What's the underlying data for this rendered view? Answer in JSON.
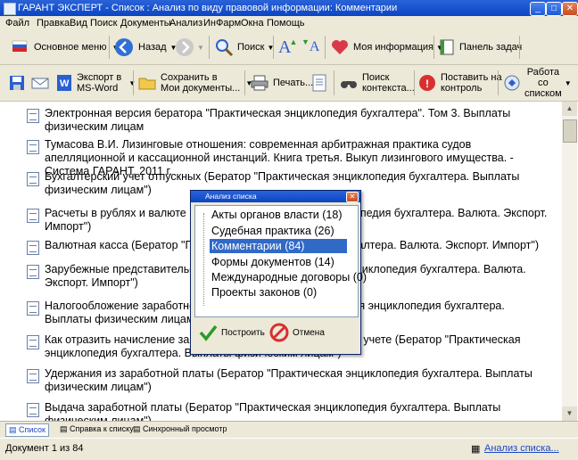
{
  "window": {
    "title": "ГАРАНТ ЭКСПЕРТ - Список : Анализ по виду правовой информации: Комментарии",
    "buttons": {
      "minimize": "_",
      "maximize": "□",
      "close": "✕"
    }
  },
  "menu": [
    "Файл",
    "Правка",
    "Вид",
    "Поиск",
    "Документы",
    "Анализ",
    "ИнФарм",
    "Окна",
    "Помощь"
  ],
  "toolbar1": {
    "main_menu": "Основное меню",
    "back": "Назад",
    "search": "Поиск",
    "my_info": "Моя информация",
    "tasks_panel": "Панель задач"
  },
  "toolbar2": {
    "export_l1": "Экспорт в",
    "export_l2": "MS-Word",
    "save_l1": "Сохранить в",
    "save_l2": "Мои документы...",
    "print": "Печать...",
    "ctx_l1": "Поиск",
    "ctx_l2": "контекста...",
    "control_l1": "Поставить на",
    "control_l2": "контроль",
    "work_l1": "Работа",
    "work_l2": "со",
    "work_l3": "списком"
  },
  "documents": [
    "Электронная версия бератора \"Практическая энциклопедия бухгалтера\". Том 3. Выплаты физическим лицам",
    "Тумасова В.И. Лизинговые отношения: современная арбитражная практика судов апелляционной и кассационной инстанций. Книга третья. Выкуп лизингового имущества. - Система ГАРАНТ, 2011 г.",
    "Бухгалтерский учет отпускных (Бератор \"Практическая энциклопедия бухгалтера. Выплаты физическим лицам\")",
    "Расчеты в рублях и валюте (Бератор \"Практическая энциклопедия бухгалтера. Валюта. Экспорт. Импорт\")",
    "Валютная касса (Бератор \"Практическая энциклопедия бухгалтера. Валюта. Экспорт. Импорт\")",
    "Зарубежные представительства (Бератор \"Практическая энциклопедия бухгалтера. Валюта. Экспорт. Импорт\")",
    "Налогообложение заработной платы (Бератор \"Практическая энциклопедия бухгалтера. Выплаты физическим лицам\")",
    "Как отразить начисление заработной платы в бухгалтерском учете (Бератор \"Практическая энциклопедия бухгалтера. Выплаты физическим лицам\")",
    "Удержания из заработной платы (Бератор \"Практическая энциклопедия бухгалтера. Выплаты физическим лицам\")",
    "Выдача заработной платы (Бератор \"Практическая энциклопедия бухгалтера. Выплаты физическим лицам\")"
  ],
  "dialog": {
    "title": "Анализ списка",
    "items": [
      "Акты органов власти (18)",
      "Судебная практика (26)",
      "Комментарии (84)",
      "Формы документов (14)",
      "Международные договоры (0)",
      "Проекты законов (0)"
    ],
    "selected_index": 2,
    "build": "Построить",
    "cancel": "Отмена"
  },
  "tabs": [
    "Список",
    "Справка к списку",
    "Синхронный просмотр"
  ],
  "status": {
    "text": "Документ 1 из 84",
    "analysis_link": "Анализ списка..."
  },
  "colors": {
    "titlebar": "#0b45c4",
    "toolbar_bg": "#ece9d8",
    "selection": "#3169c6",
    "link": "#1a47c6"
  }
}
